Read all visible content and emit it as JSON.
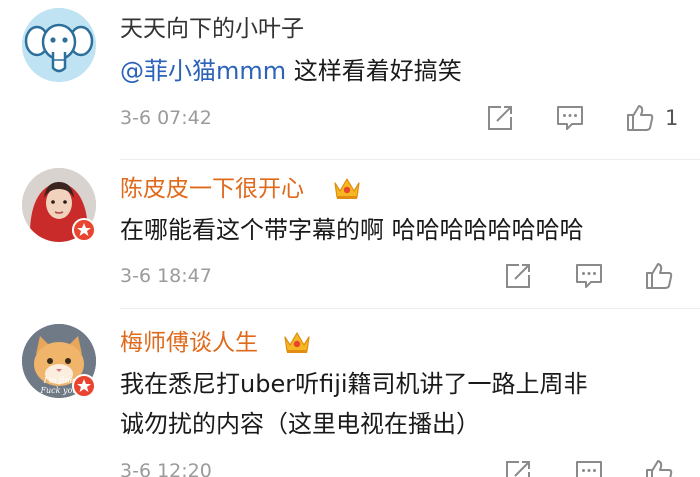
{
  "comments": [
    {
      "username": "天天向下的小叶子",
      "mention": "@菲小猫mmm",
      "text": "这样看着好搞笑",
      "time": "3-6 07:42",
      "like_count": "1",
      "avatar_icon": "elephant-icon",
      "verified_badge": false,
      "vip_crown": false
    },
    {
      "username": "陈皮皮一下很开心",
      "text": "在哪能看这个带字幕的啊 哈哈哈哈哈哈哈哈",
      "time": "3-6 18:47",
      "like_count": "",
      "avatar_icon": "red-hood-person-icon",
      "verified_badge": true,
      "vip_crown": true
    },
    {
      "username": "梅师傅谈人生",
      "text_line1": "我在悉尼打uber听fiji籍司机讲了一路上周非",
      "text_line2": "诚勿扰的内容（这里电视在播出）",
      "time": "3-6 12:20",
      "like_count": "",
      "avatar_icon": "cat-meme-icon",
      "avatar_caption": "I'm fine Fuck you",
      "verified_badge": true,
      "vip_crown": true
    }
  ],
  "actions": {
    "share_icon": "share-icon",
    "comment_icon": "comment-icon",
    "like_icon": "thumbs-up-icon"
  },
  "colors": {
    "username_orange": "#e06a1c",
    "username_gray": "#333333",
    "mention_blue": "#2c63b8",
    "timestamp_gray": "#9b9b9b",
    "badge_red": "#e8442f",
    "icon_gray": "#8a8a8a"
  }
}
